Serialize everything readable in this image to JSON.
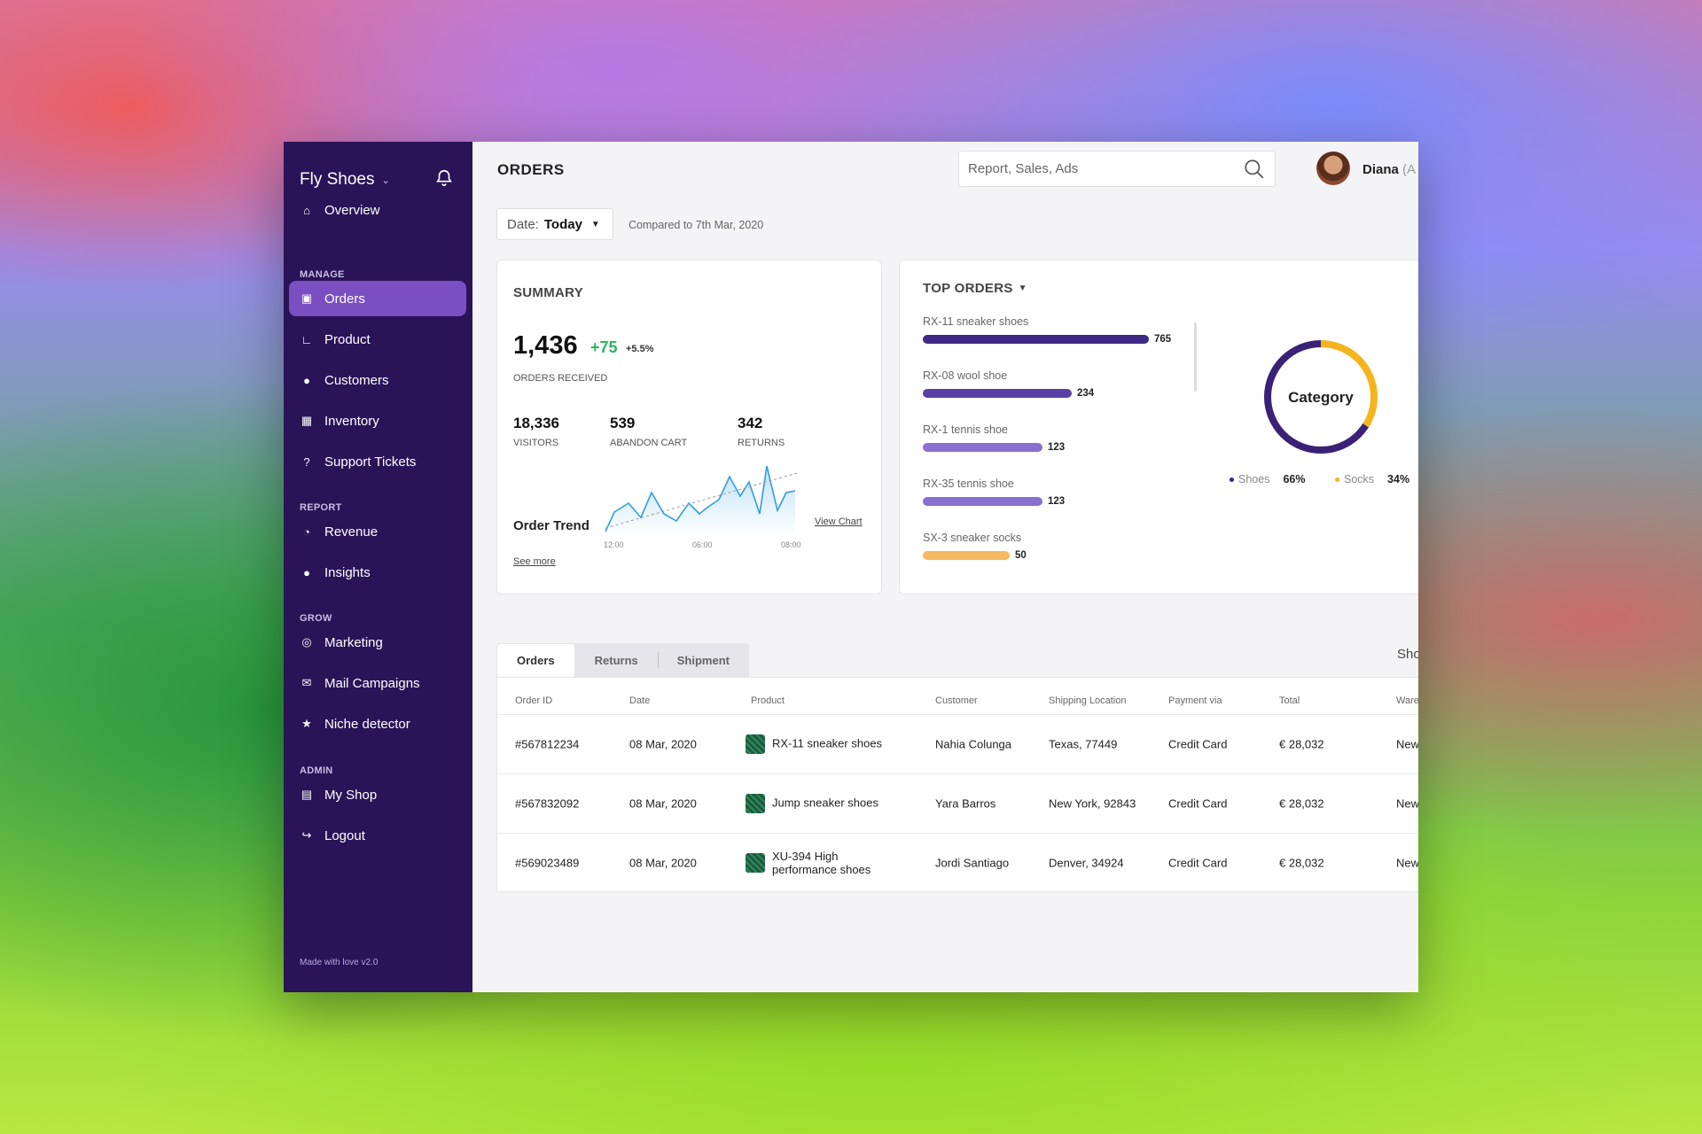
{
  "sidebar": {
    "brand": "Fly Shoes",
    "overview": "Overview",
    "sections": {
      "manage": "MANAGE",
      "report": "REPORT",
      "grow": "GROW",
      "admin": "ADMIN"
    },
    "manage_items": [
      "Orders",
      "Product",
      "Customers",
      "Inventory",
      "Support Tickets"
    ],
    "report_items": [
      "Revenue",
      "Insights"
    ],
    "grow_items": [
      "Marketing",
      "Mail Campaigns",
      "Niche detector"
    ],
    "admin_items": [
      "My Shop",
      "Logout"
    ],
    "footer": "Made with love v2.0",
    "active_color": "#7b4fc2",
    "bg_color": "#2b1358"
  },
  "header": {
    "title": "ORDERS",
    "search_placeholder": "Report, Sales, Ads",
    "user_name": "Diana",
    "user_suffix": "(A"
  },
  "filter": {
    "date_label": "Date:",
    "date_value": "Today",
    "compared": "Compared to 7th Mar, 2020"
  },
  "summary": {
    "title": "SUMMARY",
    "orders_value": "1,436",
    "orders_delta": "+75",
    "orders_pct": "+5.5%",
    "orders_label": "ORDERS RECEIVED",
    "stats": [
      {
        "value": "18,336",
        "label": "VISITORS"
      },
      {
        "value": "539",
        "label": "ABANDON CART"
      },
      {
        "value": "342",
        "label": "RETURNS"
      }
    ],
    "trend_label": "Order Trend",
    "see_more": "See more",
    "view_chart": "View Chart",
    "ticks": [
      "12:00",
      "06:00",
      "08:00"
    ]
  },
  "top_orders": {
    "title": "TOP ORDERS",
    "items": [
      {
        "name": "RX-11 sneaker shoes",
        "value": 765,
        "label": "765",
        "color": "#3f2a85"
      },
      {
        "name": "RX-08 wool shoe",
        "value": 234,
        "label": "234",
        "color": "#5a3fa6"
      },
      {
        "name": "RX-1 tennis shoe",
        "value": 123,
        "label": "123",
        "color": "#8a6fd0"
      },
      {
        "name": "RX-35 tennis shoe",
        "value": 123,
        "label": "123",
        "color": "#8a6fd0"
      },
      {
        "name": "SX-3 sneaker socks",
        "value": 50,
        "label": "50",
        "color": "#f6b860"
      }
    ],
    "category": {
      "title": "Category",
      "segments": [
        {
          "name": "Shoes",
          "percent_label": "66%",
          "value": 66,
          "color": "#3a2178"
        },
        {
          "name": "Socks",
          "percent_label": "34%",
          "value": 34,
          "color": "#f5b41e"
        }
      ]
    }
  },
  "orders_table": {
    "tabs": [
      "Orders",
      "Returns",
      "Shipment"
    ],
    "show_label": "Show:",
    "columns": [
      "Order ID",
      "Date",
      "Product",
      "Customer",
      "Shipping Location",
      "Payment via",
      "Total",
      "Warehous"
    ],
    "rows": [
      [
        "#567812234",
        "08 Mar, 2020",
        "RX-11 sneaker shoes",
        "Nahia Colunga",
        "Texas, 77449",
        "Credit Card",
        "€ 28,032",
        "New Del"
      ],
      [
        "#567832092",
        "08 Mar, 2020",
        "Jump sneaker shoes",
        "Yara Barros",
        "New York, 92843",
        "Credit Card",
        "€ 28,032",
        "New Del"
      ],
      [
        "#569023489",
        "08 Mar, 2020",
        "XU-394 High performance shoes",
        "Jordi Santiago",
        "Denver, 34924",
        "Credit Card",
        "€ 28,032",
        "New Del"
      ]
    ]
  }
}
